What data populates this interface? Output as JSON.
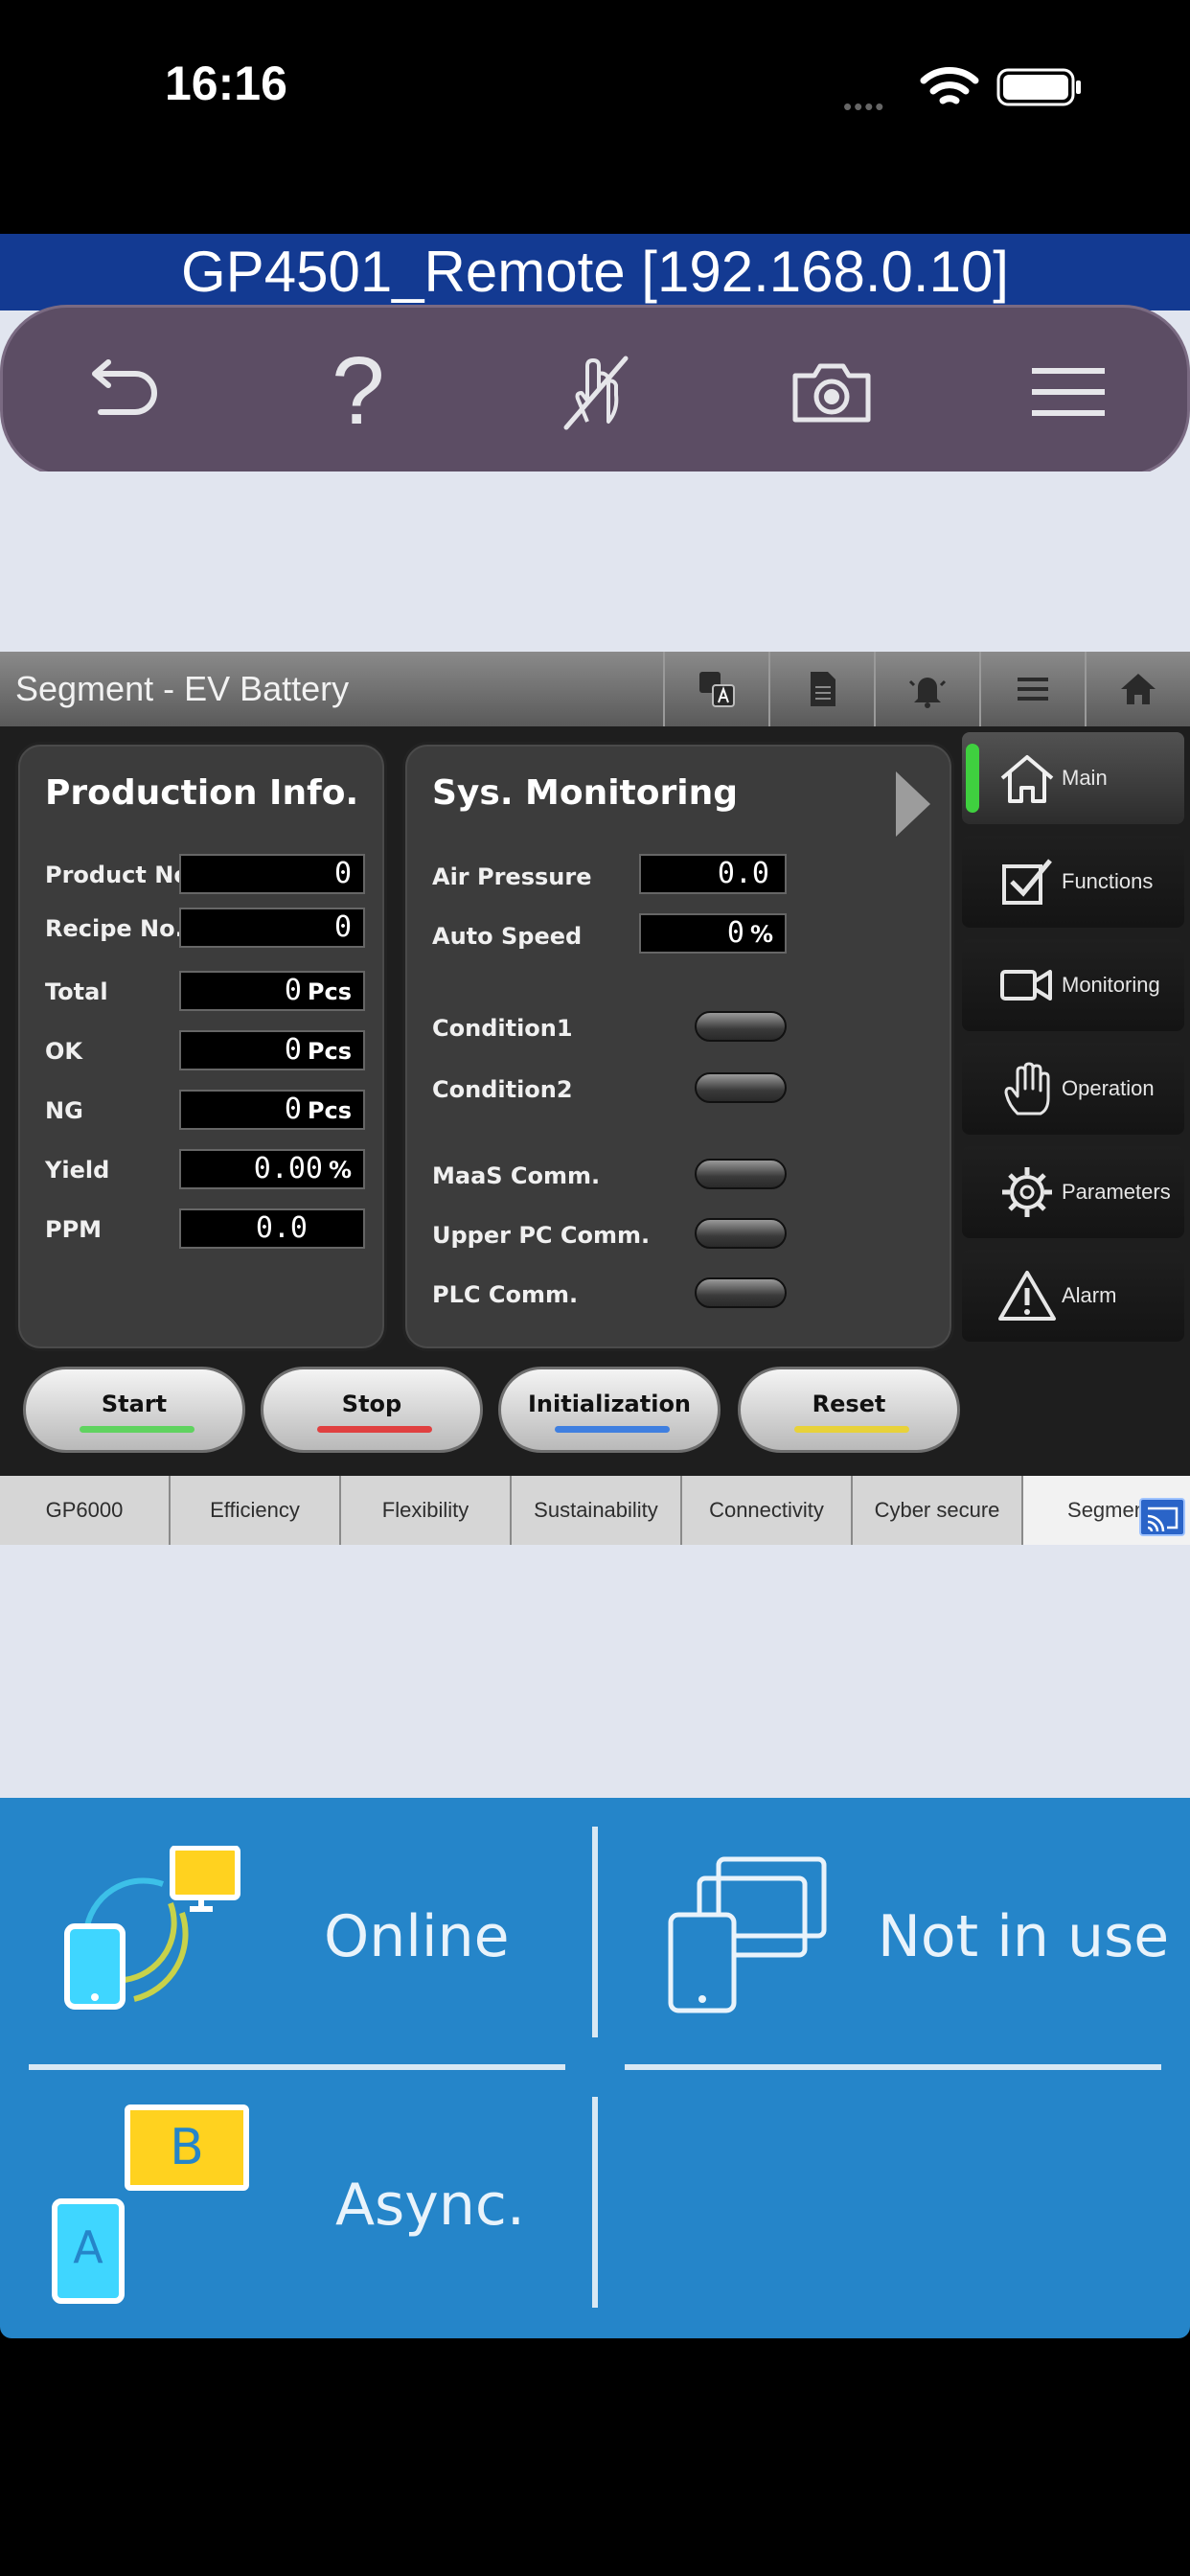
{
  "status_bar": {
    "time": "16:16",
    "signal_dots": "••••"
  },
  "app": {
    "title": "GP4501_Remote [192.168.0.10]"
  },
  "toolbar": {
    "back_icon": "return-icon",
    "help_label": "?",
    "touch_icon": "touch-disabled-icon",
    "capture_icon": "camera-icon",
    "menu_icon": "hamburger-menu-icon"
  },
  "hmi": {
    "title": "Segment - EV Battery",
    "header_icons": [
      "translate-icon",
      "document-icon",
      "alarm-bell-icon",
      "list-icon",
      "home-icon"
    ],
    "production": {
      "title": "Production Info.",
      "rows": [
        {
          "label": "Product No.",
          "value": "0",
          "unit": ""
        },
        {
          "label": "Recipe No.",
          "value": "0",
          "unit": ""
        },
        {
          "label": "Total",
          "value": "0",
          "unit": "Pcs"
        },
        {
          "label": "OK",
          "value": "0",
          "unit": "Pcs"
        },
        {
          "label": "NG",
          "value": "0",
          "unit": "Pcs"
        },
        {
          "label": "Yield",
          "value": "0.00",
          "unit": "%"
        },
        {
          "label": "PPM",
          "value": "0.0",
          "unit": ""
        }
      ]
    },
    "monitoring": {
      "title": "Sys. Monitoring",
      "values": [
        {
          "label": "Air Pressure",
          "value": "0.0",
          "unit": ""
        },
        {
          "label": "Auto Speed",
          "value": "0",
          "unit": "%"
        }
      ],
      "indicators": [
        {
          "label": "Condition1"
        },
        {
          "label": "Condition2"
        },
        {
          "label": "MaaS Comm."
        },
        {
          "label": "Upper PC Comm."
        },
        {
          "label": "PLC Comm."
        }
      ]
    },
    "nav": [
      {
        "label": "Main",
        "icon": "home-icon",
        "active": true
      },
      {
        "label": "Functions",
        "icon": "checkbox-icon",
        "active": false
      },
      {
        "label": "Monitoring",
        "icon": "video-camera-icon",
        "active": false
      },
      {
        "label": "Operation",
        "icon": "hand-icon",
        "active": false
      },
      {
        "label": "Parameters",
        "icon": "gear-icon",
        "active": false
      },
      {
        "label": "Alarm",
        "icon": "warning-icon",
        "active": false
      }
    ],
    "actions": [
      {
        "label": "Start",
        "color": "#5fd35f"
      },
      {
        "label": "Stop",
        "color": "#e04040"
      },
      {
        "label": "Initialization",
        "color": "#3f7fe0"
      },
      {
        "label": "Reset",
        "color": "#e8d23a"
      }
    ],
    "tabs": [
      {
        "label": "GP6000",
        "active": false
      },
      {
        "label": "Efficiency",
        "active": false
      },
      {
        "label": "Flexibility",
        "active": false
      },
      {
        "label": "Sustainability",
        "active": false
      },
      {
        "label": "Connectivity",
        "active": false
      },
      {
        "label": "Cyber secure",
        "active": false
      },
      {
        "label": "Segmen",
        "active": true
      }
    ]
  },
  "status_tiles": {
    "connection": "Online",
    "usage": "Not in use",
    "mode": "Async.",
    "mode_badge_a": "A",
    "mode_badge_b": "B"
  },
  "colors": {
    "title_bar": "#133a92",
    "toolbar": "#5c4d64",
    "status_area": "#2585c9",
    "active_accent": "#3fd03f"
  }
}
